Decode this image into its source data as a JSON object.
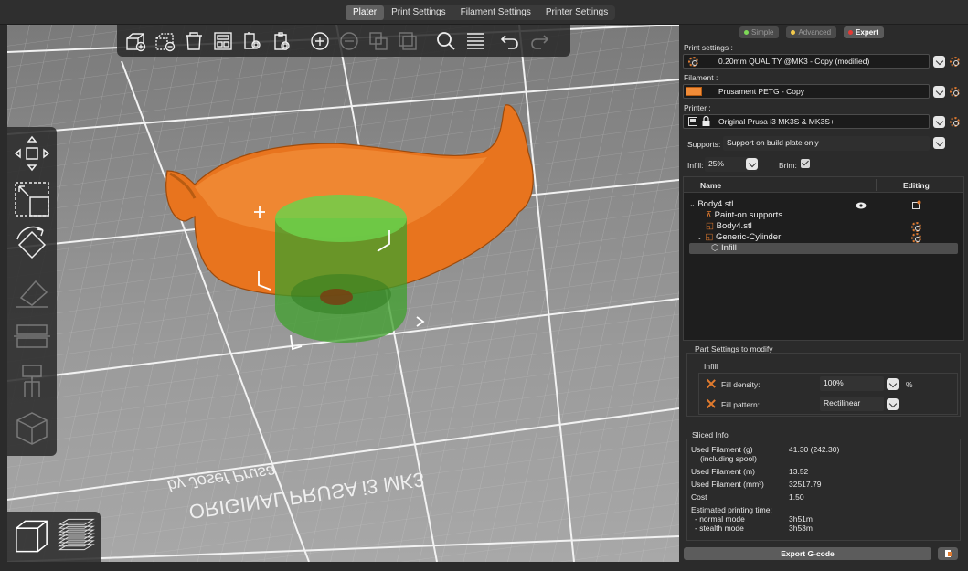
{
  "tabs": [
    "Plater",
    "Print Settings",
    "Filament Settings",
    "Printer Settings"
  ],
  "active_tab": "Plater",
  "modes": [
    {
      "label": "Simple",
      "dot": "#7ed957",
      "active": false
    },
    {
      "label": "Advanced",
      "dot": "#f2c94c",
      "active": false
    },
    {
      "label": "Expert",
      "dot": "#e53935",
      "active": true
    }
  ],
  "print_settings": {
    "label": "Print settings :",
    "value": "0.20mm QUALITY @MK3 - Copy (modified)"
  },
  "filament": {
    "label": "Filament :",
    "value": "Prusament PETG - Copy",
    "color": "#f28c38"
  },
  "printer": {
    "label": "Printer :",
    "value": "Original Prusa i3 MK3S & MK3S+"
  },
  "supports": {
    "label": "Supports:",
    "value": "Support on build plate only"
  },
  "infill": {
    "label": "Infill:",
    "value": "25%"
  },
  "brim": {
    "label": "Brim:",
    "checked": true
  },
  "object_list": {
    "col_name": "Name",
    "col_editing": "Editing",
    "items": [
      {
        "label": "Body4.stl"
      },
      {
        "label": "Paint-on supports"
      },
      {
        "label": "Body4.stl"
      },
      {
        "label": "Generic-Cylinder"
      },
      {
        "label": "Infill"
      }
    ]
  },
  "part_settings": {
    "title": "Part Settings to modify",
    "group": "Infill",
    "density_label": "Fill density:",
    "density_value": "100%",
    "density_unit": "%",
    "pattern_label": "Fill pattern:",
    "pattern_value": "Rectilinear"
  },
  "sliced_info": {
    "title": "Sliced Info",
    "rows": [
      {
        "label": "Used Filament (g)",
        "value": "41.30 (242.30)"
      },
      {
        "label": "(including spool)",
        "value": ""
      },
      {
        "label": "Used Filament (m)",
        "value": "13.52"
      },
      {
        "label": "Used Filament (mm³)",
        "value": "32517.79"
      },
      {
        "label": "Cost",
        "value": "1.50"
      },
      {
        "label": "Estimated printing time:",
        "value": ""
      },
      {
        "label": "- normal mode",
        "value": "3h51m"
      },
      {
        "label": "- stealth mode",
        "value": "3h53m"
      }
    ]
  },
  "export_label": "Export G-code",
  "bed_text": {
    "line1": "ORIGINAL PRUSA i3 MK3",
    "line2": "by Josef Prusa"
  },
  "toolbar_icons": [
    "add-object-icon",
    "delete-icon",
    "delete-all-icon",
    "arrange-icon",
    "copy-icon",
    "paste-icon",
    "add-instance-icon",
    "remove-instance-icon",
    "split-objects-icon",
    "split-parts-icon",
    "search-icon",
    "layers-editing-icon",
    "undo-icon",
    "redo-icon"
  ],
  "left_tool_icons": [
    "move-icon",
    "scale-icon",
    "rotate-icon",
    "place-on-face-icon",
    "cut-icon",
    "hollow-icon",
    "paint-supports-icon",
    "seam-paint-icon"
  ],
  "view_icons": [
    "3d-view-icon",
    "preview-icon"
  ]
}
